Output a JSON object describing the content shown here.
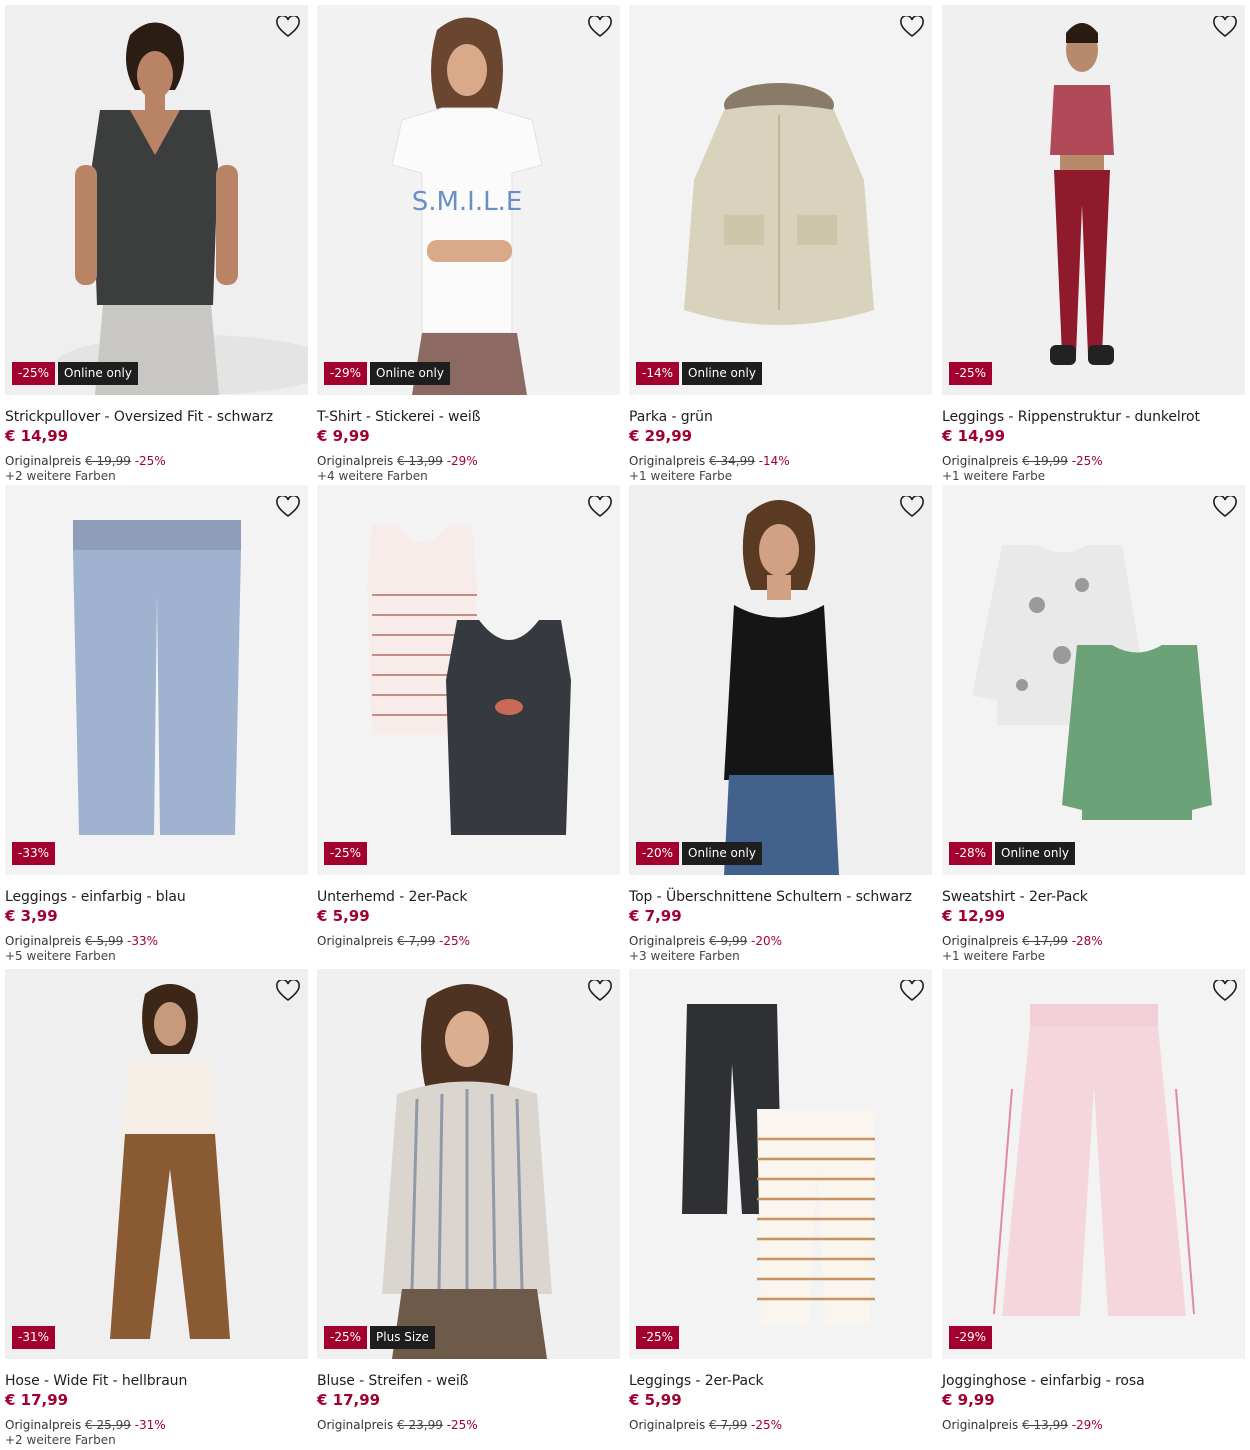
{
  "accent_color": "#a2002f",
  "products": [
    {
      "name": "Strickpullover - Oversized Fit - schwarz",
      "price": "€ 14,99",
      "orig_label": "Originalpreis",
      "old_price": "€ 19,99",
      "pct": "-25%",
      "discount": "-25%",
      "tag": "Online only",
      "colors": "+2 weitere Farben",
      "icon": "model-vest"
    },
    {
      "name": "T-Shirt - Stickerei - weiß",
      "price": "€ 9,99",
      "orig_label": "Originalpreis",
      "old_price": "€ 13,99",
      "pct": "-29%",
      "discount": "-29%",
      "tag": "Online only",
      "colors": "+4 weitere Farben",
      "icon": "model-tshirt"
    },
    {
      "name": "Parka - grün",
      "price": "€ 29,99",
      "orig_label": "Originalpreis",
      "old_price": "€ 34,99",
      "pct": "-14%",
      "discount": "-14%",
      "tag": "Online only",
      "colors": "+1 weitere Farbe",
      "icon": "parka"
    },
    {
      "name": "Leggings - Rippenstruktur - dunkelrot",
      "price": "€ 14,99",
      "orig_label": "Originalpreis",
      "old_price": "€ 19,99",
      "pct": "-25%",
      "discount": "-25%",
      "tag": "",
      "colors": "+1 weitere Farbe",
      "icon": "model-leggings"
    },
    {
      "name": "Leggings - einfarbig - blau",
      "price": "€ 3,99",
      "orig_label": "Originalpreis",
      "old_price": "€ 5,99",
      "pct": "-33%",
      "discount": "-33%",
      "tag": "",
      "colors": "+5 weitere Farben",
      "icon": "leggings-blue"
    },
    {
      "name": "Unterhemd - 2er-Pack",
      "price": "€ 5,99",
      "orig_label": "Originalpreis",
      "old_price": "€ 7,99",
      "pct": "-25%",
      "discount": "-25%",
      "tag": "",
      "colors": "",
      "icon": "undershirts"
    },
    {
      "name": "Top - Überschnittene Schultern - schwarz",
      "price": "€ 7,99",
      "orig_label": "Originalpreis",
      "old_price": "€ 9,99",
      "pct": "-20%",
      "discount": "-20%",
      "tag": "Online only",
      "colors": "+3 weitere Farben",
      "icon": "model-top"
    },
    {
      "name": "Sweatshirt - 2er-Pack",
      "price": "€ 12,99",
      "orig_label": "Originalpreis",
      "old_price": "€ 17,99",
      "pct": "-28%",
      "discount": "-28%",
      "tag": "Online only",
      "colors": "+1 weitere Farbe",
      "icon": "sweatshirts"
    },
    {
      "name": "Hose - Wide Fit - hellbraun",
      "price": "€ 17,99",
      "orig_label": "Originalpreis",
      "old_price": "€ 25,99",
      "pct": "-31%",
      "discount": "-31%",
      "tag": "",
      "colors": "+2 weitere Farben",
      "icon": "model-pants"
    },
    {
      "name": "Bluse - Streifen - weiß",
      "price": "€ 17,99",
      "orig_label": "Originalpreis",
      "old_price": "€ 23,99",
      "pct": "-25%",
      "discount": "-25%",
      "tag": "Plus Size",
      "colors": "",
      "icon": "model-blouse"
    },
    {
      "name": "Leggings - 2er-Pack",
      "price": "€ 5,99",
      "orig_label": "Originalpreis",
      "old_price": "€ 7,99",
      "pct": "-25%",
      "discount": "-25%",
      "tag": "",
      "colors": "",
      "icon": "leggings-pack"
    },
    {
      "name": "Jogginghose - einfarbig - rosa",
      "price": "€ 9,99",
      "orig_label": "Originalpreis",
      "old_price": "€ 13,99",
      "pct": "-29%",
      "discount": "-29%",
      "tag": "",
      "colors": "",
      "icon": "joggers-pink"
    }
  ]
}
